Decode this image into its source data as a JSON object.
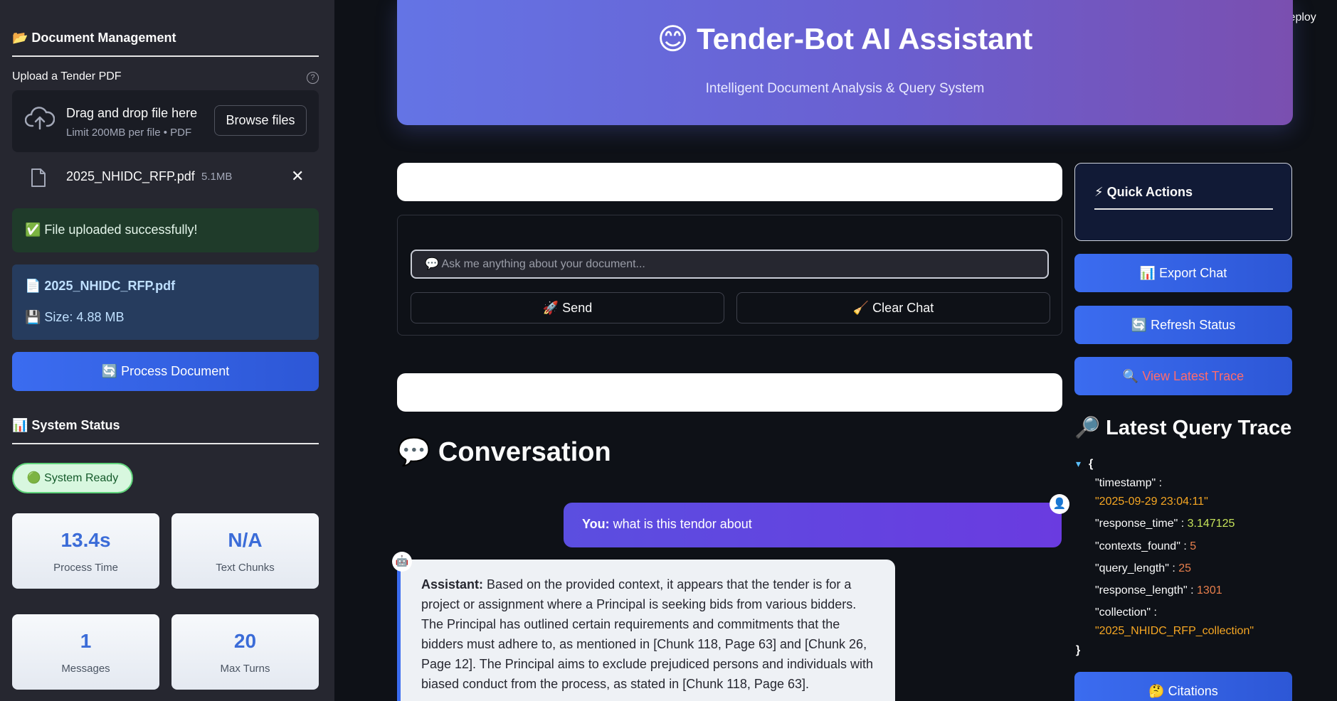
{
  "sidebar": {
    "doc_header": "📂 Document Management",
    "upload_label": "Upload a Tender PDF",
    "help_glyph": "?",
    "dropzone": {
      "title": "Drag and drop file here",
      "subtitle": "Limit 200MB per file • PDF",
      "browse_label": "Browse files"
    },
    "uploaded_file": {
      "name": "2025_NHIDC_RFP.pdf",
      "size": "5.1MB",
      "remove_glyph": "✕"
    },
    "success_message": "✅ File uploaded successfully!",
    "file_info": {
      "name": "📄 2025_NHIDC_RFP.pdf",
      "size": "💾 Size: 4.88 MB"
    },
    "process_label": "🔄 Process Document",
    "status_header": "📊 System Status",
    "status_badge": "🟢 System Ready",
    "metrics": [
      {
        "value": "13.4s",
        "label": "Process Time"
      },
      {
        "value": "N/A",
        "label": "Text Chunks"
      },
      {
        "value": "1",
        "label": "Messages"
      },
      {
        "value": "20",
        "label": "Max Turns"
      }
    ]
  },
  "header": {
    "deploy_label": "Deploy",
    "title": "😊 Tender-Bot AI Assistant",
    "subtitle": "Intelligent Document Analysis & Query System"
  },
  "chat_form": {
    "input_placeholder": "💬 Ask me anything about your document...",
    "send_label": "🚀 Send",
    "clear_label": "🧹 Clear Chat"
  },
  "conversation": {
    "title": "💬 Conversation",
    "user_avatar": "👤",
    "assistant_avatar": "🤖",
    "user_prefix": "You:",
    "user_message": "what is this tendor about",
    "assistant_prefix": "Assistant:",
    "assistant_message": "Based on the provided context, it appears that the tender is for a project or assignment where a Principal is seeking bids from various bidders. The Principal has outlined certain requirements and commitments that the bidders must adhere to, as mentioned in [Chunk 118, Page 63] and [Chunk 26, Page 12]. The Principal aims to exclude prejudiced persons and individuals with biased conduct from the process, as stated in [Chunk 118, Page 63]."
  },
  "quick_actions": {
    "title": "⚡ Quick Actions",
    "export_label": "📊 Export Chat",
    "refresh_label": "🔄 Refresh Status",
    "view_trace_icon": "🔍",
    "view_trace_label": "View Latest Trace",
    "citations_label": "🤔 Citations"
  },
  "trace": {
    "title": "🔎 Latest Query Trace",
    "open_brace": "{",
    "close_brace": "}",
    "toggle_glyph": "▾",
    "entries": [
      {
        "key": "\"timestamp\"",
        "value": "\"2025-09-29 23:04:11\""
      },
      {
        "key": "\"response_time\"",
        "value": "3.147125"
      },
      {
        "key": "\"contexts_found\"",
        "value": "5"
      },
      {
        "key": "\"query_length\"",
        "value": "25"
      },
      {
        "key": "\"response_length\"",
        "value": "1301"
      },
      {
        "key": "\"collection\"",
        "value": "\"2025_NHIDC_RFP_collection\""
      }
    ]
  },
  "colors": {
    "accent_blue": "#3b6cf0",
    "hero_gradient_start": "#6474e5",
    "hero_gradient_end": "#7a4fb0",
    "success_bg": "#1f3b2a",
    "trace_link": "#ff6b6b"
  }
}
